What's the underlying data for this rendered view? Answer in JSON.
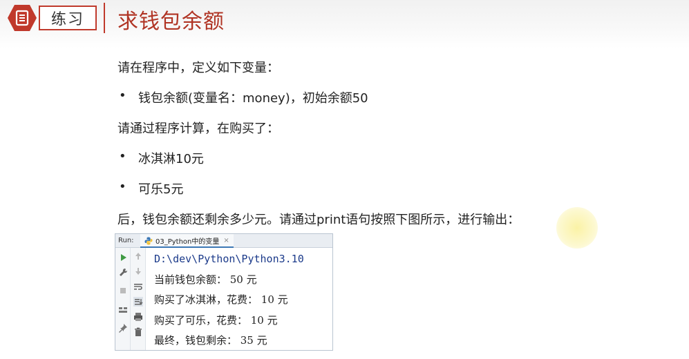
{
  "header": {
    "badge_label": "练习",
    "title": "求钱包余额"
  },
  "content": {
    "line1": "请在程序中，定义如下变量：",
    "bullet1": "钱包余额(变量名：money)，初始余额50",
    "line2": "请通过程序计算，在购买了：",
    "bullet2": "冰淇淋10元",
    "bullet3": "可乐5元",
    "line3": "后，钱包余额还剩余多少元。请通过print语句按照下图所示，进行输出："
  },
  "run_panel": {
    "run_label": "Run:",
    "tab_label": "03_Python中的变量",
    "console": [
      "D:\\dev\\Python\\Python3.10",
      "当前钱包余额： 50 元",
      "购买了冰淇淋，花费： 10 元",
      "购买了可乐，花费： 10 元",
      "最终，钱包剩余： 35 元"
    ]
  },
  "colors": {
    "accent_red": "#c0392b",
    "title_red": "#b03424"
  }
}
